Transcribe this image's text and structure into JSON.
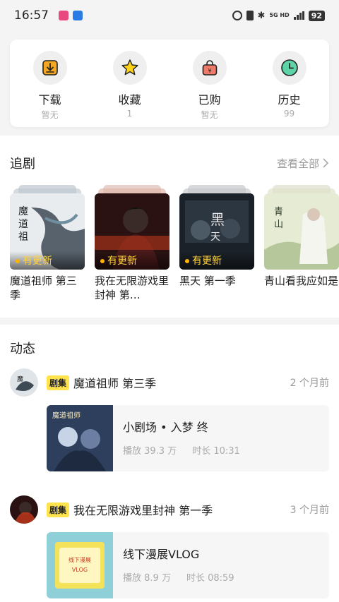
{
  "status_bar": {
    "time": "16:57",
    "network": "5G HD",
    "battery": "92"
  },
  "quick_actions": [
    {
      "label": "下载",
      "sub": "暂无",
      "icon": "download-icon"
    },
    {
      "label": "收藏",
      "sub": "1",
      "icon": "star-icon"
    },
    {
      "label": "已购",
      "sub": "暂无",
      "icon": "purchase-bag-icon"
    },
    {
      "label": "历史",
      "sub": "99",
      "icon": "clock-icon"
    }
  ],
  "following": {
    "title": "追剧",
    "see_all": "查看全部",
    "items": [
      {
        "name": "魔道祖师 第三季",
        "badge": "有更新"
      },
      {
        "name": "我在无限游戏里封神 第…",
        "badge": "有更新"
      },
      {
        "name": "黑天 第一季",
        "badge": "有更新"
      },
      {
        "name": "青山看我应如是",
        "badge": ""
      }
    ]
  },
  "feed": {
    "title": "动态",
    "items": [
      {
        "tag": "剧集",
        "series": "魔道祖师 第三季",
        "time": "2 个月前",
        "video_title": "小剧场 • 入梦 终",
        "plays": "播放 39.3 万",
        "duration": "时长 10:31"
      },
      {
        "tag": "剧集",
        "series": "我在无限游戏里封神 第一季",
        "time": "3 个月前",
        "video_title": "线下漫展VLOG",
        "plays": "播放 8.9 万",
        "duration": "时长 08:59"
      }
    ]
  },
  "colors": {
    "accent_yellow": "#ffe34d",
    "update_text": "#ffd23b",
    "background": "#f4f4f4"
  }
}
